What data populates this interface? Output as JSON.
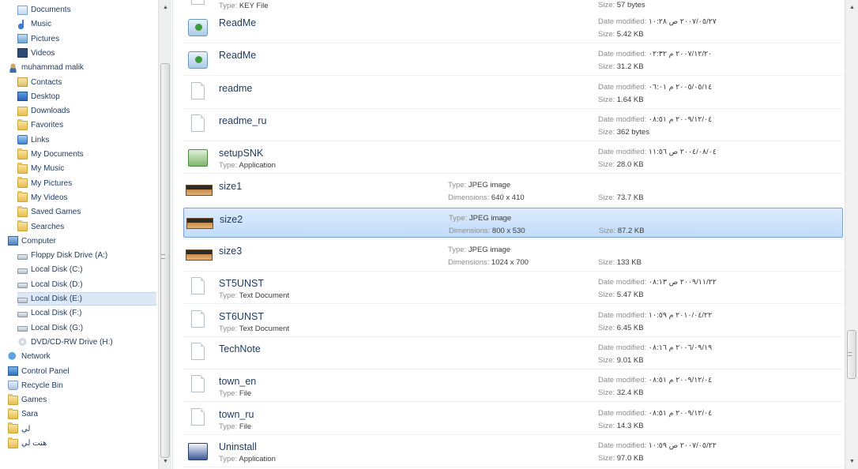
{
  "nav": {
    "items": [
      {
        "label": "Documents",
        "icon": "documents-icon",
        "indent": 1,
        "selected": false
      },
      {
        "label": "Music",
        "icon": "music-icon",
        "indent": 1,
        "selected": false
      },
      {
        "label": "Pictures",
        "icon": "pictures-icon",
        "indent": 1,
        "selected": false
      },
      {
        "label": "Videos",
        "icon": "videos-icon",
        "indent": 1,
        "selected": false
      },
      {
        "label": "muhammad malik",
        "icon": "user-folder-icon",
        "indent": 0,
        "selected": false
      },
      {
        "label": "Contacts",
        "icon": "contacts-icon",
        "indent": 1,
        "selected": false
      },
      {
        "label": "Desktop",
        "icon": "desktop-icon",
        "indent": 1,
        "selected": false
      },
      {
        "label": "Downloads",
        "icon": "downloads-icon",
        "indent": 1,
        "selected": false
      },
      {
        "label": "Favorites",
        "icon": "favorites-icon",
        "indent": 1,
        "selected": false
      },
      {
        "label": "Links",
        "icon": "links-icon",
        "indent": 1,
        "selected": false
      },
      {
        "label": "My Documents",
        "icon": "folder-icon",
        "indent": 1,
        "selected": false
      },
      {
        "label": "My Music",
        "icon": "folder-icon",
        "indent": 1,
        "selected": false
      },
      {
        "label": "My Pictures",
        "icon": "folder-icon",
        "indent": 1,
        "selected": false
      },
      {
        "label": "My Videos",
        "icon": "folder-icon",
        "indent": 1,
        "selected": false
      },
      {
        "label": "Saved Games",
        "icon": "saved-games-icon",
        "indent": 1,
        "selected": false
      },
      {
        "label": "Searches",
        "icon": "searches-icon",
        "indent": 1,
        "selected": false
      },
      {
        "label": "Computer",
        "icon": "computer-icon",
        "indent": 0,
        "selected": false
      },
      {
        "label": "Floppy Disk Drive (A:)",
        "icon": "floppy-drive-icon",
        "indent": 1,
        "selected": false
      },
      {
        "label": "Local Disk (C:)",
        "icon": "system-drive-icon",
        "indent": 1,
        "selected": false
      },
      {
        "label": "Local Disk (D:)",
        "icon": "drive-icon",
        "indent": 1,
        "selected": false
      },
      {
        "label": "Local Disk (E:)",
        "icon": "drive-icon",
        "indent": 1,
        "selected": true
      },
      {
        "label": "Local Disk (F:)",
        "icon": "drive-icon",
        "indent": 1,
        "selected": false
      },
      {
        "label": "Local Disk (G:)",
        "icon": "drive-icon",
        "indent": 1,
        "selected": false
      },
      {
        "label": "DVD/CD-RW Drive (H:)",
        "icon": "dvd-drive-icon",
        "indent": 1,
        "selected": false
      },
      {
        "label": "Network",
        "icon": "network-icon",
        "indent": 0,
        "selected": false
      },
      {
        "label": "Control Panel",
        "icon": "control-panel-icon",
        "indent": 0,
        "selected": false
      },
      {
        "label": "Recycle Bin",
        "icon": "recycle-bin-icon",
        "indent": 0,
        "selected": false
      },
      {
        "label": "Games",
        "icon": "folder-icon",
        "indent": 0,
        "selected": false
      },
      {
        "label": "Sara",
        "icon": "folder-icon",
        "indent": 0,
        "selected": false
      },
      {
        "label": "لي",
        "icon": "folder-icon",
        "indent": 0,
        "selected": false
      },
      {
        "label": "هنت لي",
        "icon": "folder-icon",
        "indent": 0,
        "selected": false
      }
    ]
  },
  "files": {
    "labels": {
      "type": "Type:",
      "size": "Size:",
      "date_modified": "Date modified:",
      "dimensions": "Dimensions:"
    },
    "partial_top": {
      "type": "KEY File",
      "size": "57 bytes"
    },
    "rows": [
      {
        "name": "ReadMe",
        "icon": "readme-icon",
        "type": "",
        "date": "٢٠٠٧/٠٥/٢٧ ص ١٠:٢٨",
        "size": "5.42 KB",
        "selected": false
      },
      {
        "name": "ReadMe",
        "icon": "readme-icon",
        "type": "",
        "date": "٢٠٠٧/١٢/٢٠ م ٠٢:٣٢",
        "size": "31.2 KB",
        "selected": false
      },
      {
        "name": "readme",
        "icon": "text-file-icon",
        "type": "",
        "date": "٢٠٠٥/٠٥/١٤ م ٠٦:٠١",
        "size": "1.64 KB",
        "selected": false
      },
      {
        "name": "readme_ru",
        "icon": "text-file-icon",
        "type": "",
        "date": "٢٠٠٩/١٢/٠٤ م ٠٨:٥١",
        "size": "362 bytes",
        "selected": false
      },
      {
        "name": "setupSNK",
        "icon": "application-icon",
        "type": "Application",
        "date": "٢٠٠٤/٠٨/٠٤ ص ١١:٥٦",
        "size": "28.0 KB",
        "selected": false
      },
      {
        "name": "size1",
        "icon": "jpeg-image-icon",
        "ptype": "JPEG image",
        "dimensions": "640 x 410",
        "size": "73.7 KB",
        "selected": false
      },
      {
        "name": "size2",
        "icon": "jpeg-image-icon",
        "ptype": "JPEG image",
        "dimensions": "800 x 530",
        "size": "87.2 KB",
        "selected": true
      },
      {
        "name": "size3",
        "icon": "jpeg-image-icon",
        "ptype": "JPEG image",
        "dimensions": "1024 x 700",
        "size": "133 KB",
        "selected": false
      },
      {
        "name": "ST5UNST",
        "icon": "text-document-icon",
        "type": "Text Document",
        "date": "٢٠٠٩/١١/٢٢ ص ٠٨:١٣",
        "size": "5.47 KB",
        "selected": false
      },
      {
        "name": "ST6UNST",
        "icon": "text-document-icon",
        "type": "Text Document",
        "date": "٢٠١٠/٠٤/٢٢ م ١٠:٥٩",
        "size": "6.45 KB",
        "selected": false
      },
      {
        "name": "TechNote",
        "icon": "text-file-icon",
        "type": "",
        "date": "٢٠٠٦/٠٩/١٩ م ٠٨:١٦",
        "size": "9.01 KB",
        "selected": false
      },
      {
        "name": "town_en",
        "icon": "file-icon",
        "type": "File",
        "date": "٢٠٠٩/١٢/٠٤ م ٠٨:٥١",
        "size": "32.4 KB",
        "selected": false
      },
      {
        "name": "town_ru",
        "icon": "file-icon",
        "type": "File",
        "date": "٢٠٠٩/١٢/٠٤ م ٠٨:٥١",
        "size": "14.3 KB",
        "selected": false
      },
      {
        "name": "Uninstall",
        "icon": "uninstall-app-icon",
        "type": "Application",
        "date": "٢٠٠٧/٠٥/٢٢ ص ١٠:٥٩",
        "size": "97.0 KB",
        "selected": false
      }
    ]
  }
}
